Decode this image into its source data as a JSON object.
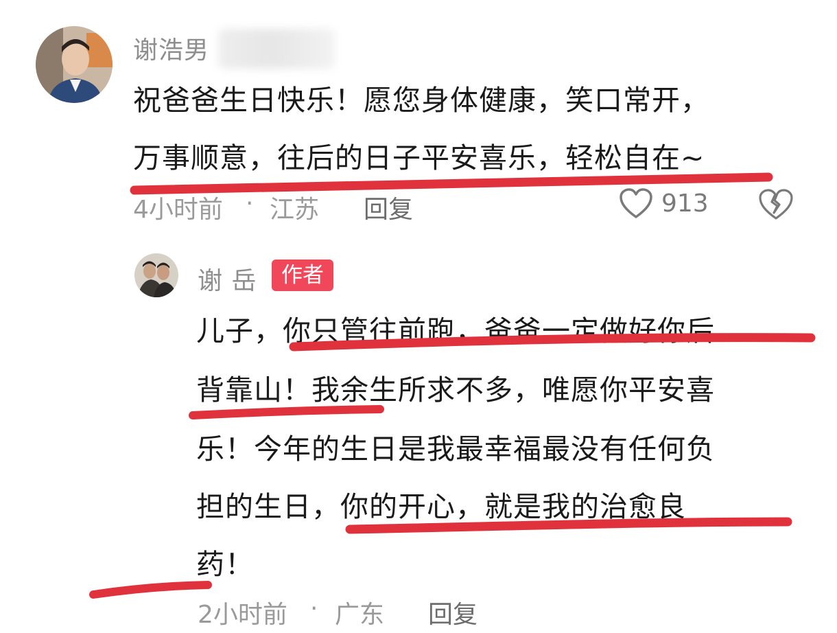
{
  "comment": {
    "username": "谢浩男",
    "lines": [
      "祝爸爸生日快乐！愿您身体健康，笑口常开，",
      "万事顺意，往后的日子平安喜乐，轻松自在~"
    ],
    "time": "4小时前",
    "separator": "·",
    "location": "江苏",
    "reply_label": "回复",
    "like_count": "913"
  },
  "reply": {
    "username": "谢 岳",
    "badge": "作者",
    "lines": [
      "儿子，你只管往前跑，爸爸一定做好你后",
      "背靠山！我余生所求不多，唯愿你平安喜",
      "乐！今年的生日是我最幸福最没有任何负",
      "担的生日，你的开心，就是我的治愈良",
      "药！"
    ],
    "time": "2小时前",
    "separator": "·",
    "location": "广东",
    "reply_label": "回复"
  },
  "colors": {
    "underline": "#e0323c",
    "badge": "#f0485a",
    "meta": "#9a9a9a"
  },
  "icons": [
    "heart-outline-icon",
    "broken-heart-icon"
  ]
}
